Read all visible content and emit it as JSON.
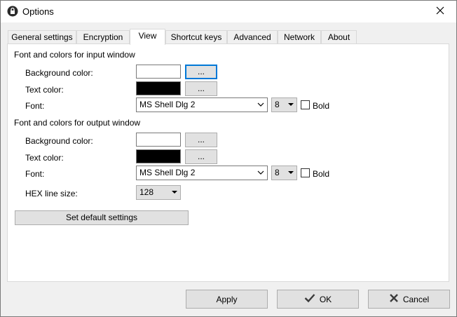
{
  "window": {
    "title": "Options",
    "close_label": "×"
  },
  "tabs": [
    {
      "label": "General settings"
    },
    {
      "label": "Encryption"
    },
    {
      "label": "View"
    },
    {
      "label": "Shortcut keys"
    },
    {
      "label": "Advanced"
    },
    {
      "label": "Network"
    },
    {
      "label": "About"
    }
  ],
  "input_window": {
    "title": "Font and colors for input window",
    "background_label": "Background color:",
    "background_color": "#ffffff",
    "text_label": "Text color:",
    "text_color": "#000000",
    "browse_label": "...",
    "font_label": "Font:",
    "font_value": "MS Shell Dlg 2",
    "size_value": "8",
    "bold_label": "Bold"
  },
  "output_window": {
    "title": "Font and colors for output window",
    "background_label": "Background color:",
    "background_color": "#ffffff",
    "text_label": "Text color:",
    "text_color": "#000000",
    "browse_label": "...",
    "font_label": "Font:",
    "font_value": "MS Shell Dlg 2",
    "size_value": "8",
    "bold_label": "Bold"
  },
  "hex": {
    "label": "HEX line size:",
    "value": "128"
  },
  "default_button": "Set default settings",
  "footer": {
    "apply": "Apply",
    "ok": "OK",
    "cancel": "Cancel"
  }
}
